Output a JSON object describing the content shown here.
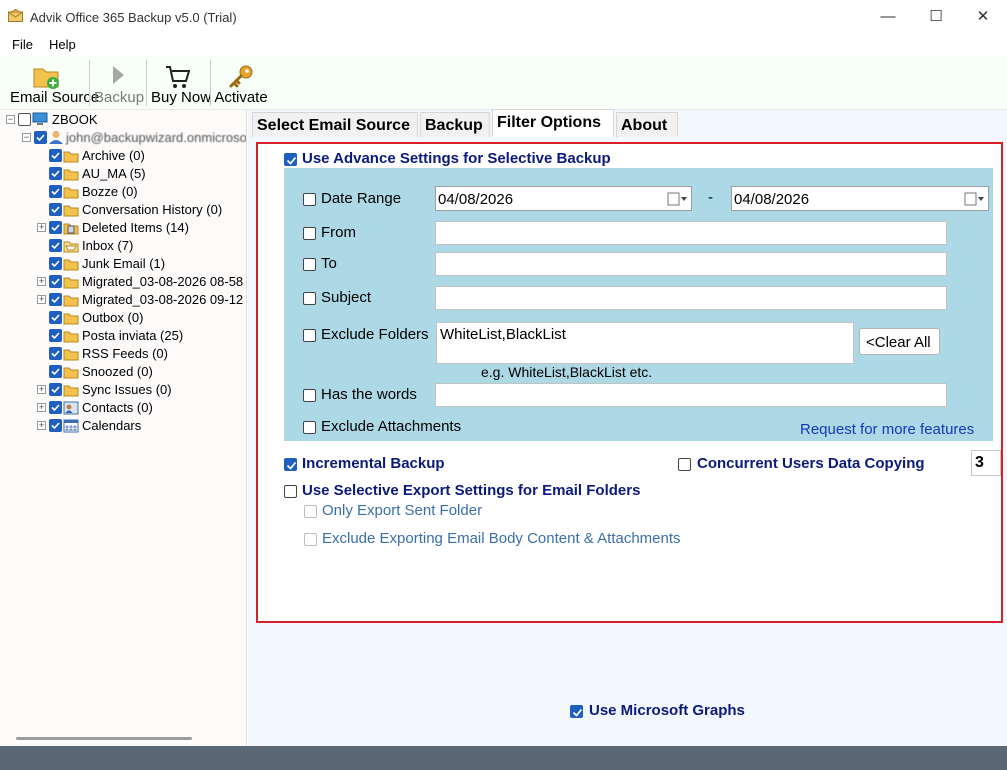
{
  "window": {
    "title": "Advik Office 365 Backup v5.0 (Trial)"
  },
  "menu": [
    "File",
    "Help"
  ],
  "toolbar": {
    "email_source": "Email Source",
    "backup": "Backup",
    "buy_now": "Buy Now",
    "activate": "Activate"
  },
  "tree": {
    "root": "ZBOOK",
    "account": "john@backupwizard.onmicrosoft.com",
    "folders": [
      "Archive (0)",
      "AU_MA (5)",
      "Bozze (0)",
      "Conversation History (0)",
      "Deleted Items (14)",
      "Inbox (7)",
      "Junk Email (1)",
      "Migrated_03-08-2026 08-58",
      "Migrated_03-08-2026 09-12",
      "Outbox (0)",
      "Posta inviata (25)",
      "RSS Feeds (0)",
      "Snoozed (0)",
      "Sync Issues (0)",
      "Contacts (0)",
      "Calendars"
    ]
  },
  "tabs": [
    "Select Email Source",
    "Backup",
    "Filter Options",
    "About"
  ],
  "filter": {
    "use_advance": "Use Advance Settings for Selective Backup",
    "date_range": "Date Range",
    "date_from": "04/08/2026",
    "date_sep": "-",
    "date_to": "04/08/2026",
    "from": "From",
    "to": "To",
    "subject": "Subject",
    "exclude_folders": "Exclude Folders",
    "exclude_value": "WhiteList,BlackList",
    "clear_all": "<Clear All",
    "example": "e.g. WhiteList,BlackList etc.",
    "has_words": "Has the words",
    "exclude_attachments": "Exclude Attachments",
    "request_link": "Request for more features",
    "incremental": "Incremental Backup",
    "concurrent": "Concurrent Users Data Copying",
    "concurrent_value": "3",
    "selective_export": "Use Selective Export Settings for Email Folders",
    "only_sent": "Only Export Sent Folder",
    "exclude_body": "Exclude Exporting Email Body Content & Attachments",
    "ms_graphs": "Use Microsoft Graphs"
  },
  "colors": {
    "accent": "#1f5fbf",
    "panel_border": "#d8202a",
    "adv_box": "#add8e6",
    "label_blue": "#0c1a7d"
  }
}
